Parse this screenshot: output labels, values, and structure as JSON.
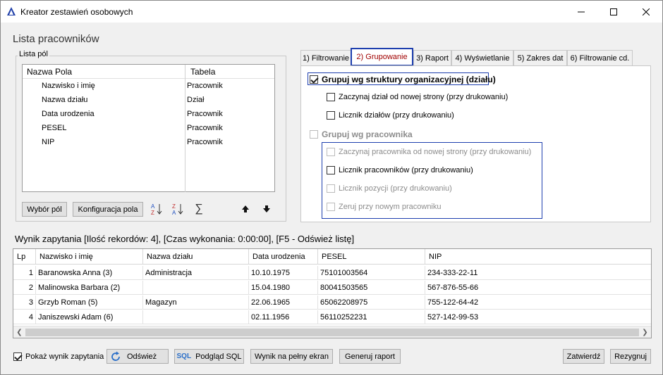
{
  "window": {
    "title": "Kreator zestawień osobowych"
  },
  "section_title": "Lista pracowników",
  "fields_group": {
    "label": "Lista pól",
    "columns": {
      "name": "Nazwa Pola",
      "table": "Tabela"
    },
    "rows": [
      {
        "name": "Nazwisko i imię",
        "table": "Pracownik"
      },
      {
        "name": "Nazwa działu",
        "table": "Dział"
      },
      {
        "name": "Data urodzenia",
        "table": "Pracownik"
      },
      {
        "name": "PESEL",
        "table": "Pracownik"
      },
      {
        "name": "NIP",
        "table": "Pracownik"
      }
    ],
    "buttons": {
      "select": "Wybór pól",
      "config": "Konfiguracja pola"
    }
  },
  "tabs": [
    {
      "label": "1) Filtrowanie"
    },
    {
      "label": "2) Grupowanie"
    },
    {
      "label": "3) Raport"
    },
    {
      "label": "4) Wyświetlanie"
    },
    {
      "label": "5) Zakres dat"
    },
    {
      "label": "6) Filtrowanie cd."
    }
  ],
  "grouping": {
    "by_structure": "Grupuj wg struktury organizacyjnej (działu)",
    "dept_new_page": "Zaczynaj dział od nowej strony (przy drukowaniu)",
    "dept_counter": "Licznik działów (przy drukowaniu)",
    "by_employee": "Grupuj wg pracownika",
    "emp_new_page": "Zaczynaj pracownika od nowej strony (przy drukowaniu)",
    "emp_counter": "Licznik pracowników (przy drukowaniu)",
    "pos_counter": "Licznik pozycji  (przy drukowaniu)",
    "reset_new_emp": "Zeruj przy nowym pracowniku"
  },
  "result": {
    "label": "Wynik zapytania [Ilość rekordów: 4], [Czas wykonania:  0:00:00], [F5 - Odśwież listę]",
    "columns": [
      "Lp",
      "Nazwisko i imię",
      "Nazwa działu",
      "Data urodzenia",
      "PESEL",
      "NIP"
    ],
    "rows": [
      [
        "1",
        "Baranowska Anna (3)",
        "Administracja",
        "10.10.1975",
        "75101003564",
        "234-333-22-11"
      ],
      [
        "2",
        "Malinowska Barbara (2)",
        "",
        "15.04.1980",
        "80041503565",
        "567-876-55-66"
      ],
      [
        "3",
        "Grzyb Roman (5)",
        "Magazyn",
        "22.06.1965",
        "65062208975",
        "755-122-64-42"
      ],
      [
        "4",
        "Janiszewski Adam (6)",
        "",
        "02.11.1956",
        "56110252231",
        "527-142-99-53"
      ]
    ]
  },
  "bottom": {
    "show_result": "Pokaż wynik zapytania",
    "refresh": "Odśwież",
    "sql_badge": "SQL",
    "sql_preview": "Podgląd SQL",
    "fullscreen": "Wynik na pełny ekran",
    "generate": "Generuj raport",
    "confirm": "Zatwierdź",
    "cancel": "Rezygnuj"
  },
  "colors": {
    "accent_border": "#1e3fae",
    "active_tab_text": "#a00000"
  }
}
